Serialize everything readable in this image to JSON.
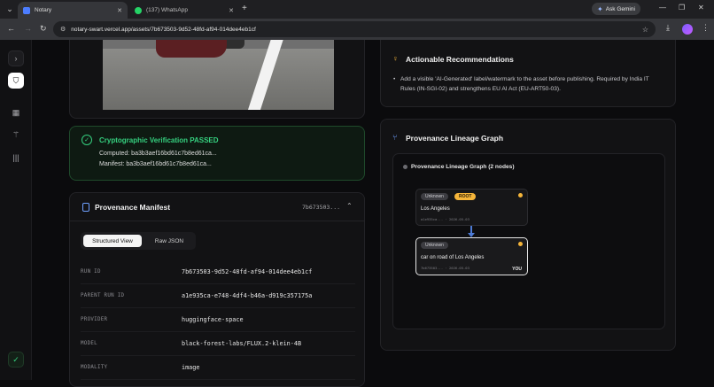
{
  "browser": {
    "tabs": [
      {
        "title": "Notary",
        "active": true
      },
      {
        "title": "(137) WhatsApp",
        "active": false
      }
    ],
    "gemini_label": "Ask Gemini",
    "url": "notary-swart.vercel.app/assets/7b673503-9d52-48fd-af94-014dee4eb1cf"
  },
  "verification": {
    "title": "Cryptographic Verification PASSED",
    "computed": "Computed: ba3b3aef16bd61c7b8ed61ca...",
    "manifest": "Manifest: ba3b3aef16bd61c7b8ed61ca..."
  },
  "manifest": {
    "title": "Provenance Manifest",
    "hash_short": "7b673503...",
    "view_structured": "Structured View",
    "view_raw": "Raw JSON",
    "rows": [
      {
        "key": "RUN ID",
        "value": "7b673503-9d52-48fd-af94-014dee4eb1cf"
      },
      {
        "key": "PARENT RUN ID",
        "value": "a1e935ca-e748-4df4-b46a-d919c357175a"
      },
      {
        "key": "PROVIDER",
        "value": "huggingface-space"
      },
      {
        "key": "MODEL",
        "value": "black-forest-labs/FLUX.2-klein-4B"
      },
      {
        "key": "MODALITY",
        "value": "image"
      }
    ]
  },
  "recommendations": {
    "title": "Actionable Recommendations",
    "items": [
      "Add a visible 'AI-Generated' label/watermark to the asset before publishing. Required by India IT Rules (IN-SGI-02) and strengthens EU AI Act (EU-ART50-03)."
    ]
  },
  "lineage": {
    "title": "Provenance Lineage Graph",
    "graph_title": "Provenance Lineage Graph (2 nodes)",
    "nodes": [
      {
        "badge": "Unknown",
        "tag": "ROOT",
        "name": "Los Angeles",
        "meta": "a1e935ca... · 2026-05-03"
      },
      {
        "badge": "Unknown",
        "name": "car on road of Los Angeles",
        "meta": "7b673503... · 2026-05-03",
        "you": "YOU"
      }
    ]
  },
  "colors": {
    "accent_green": "#35d07f",
    "accent_blue": "#6fa0ff",
    "accent_amber": "#f5b53a"
  }
}
